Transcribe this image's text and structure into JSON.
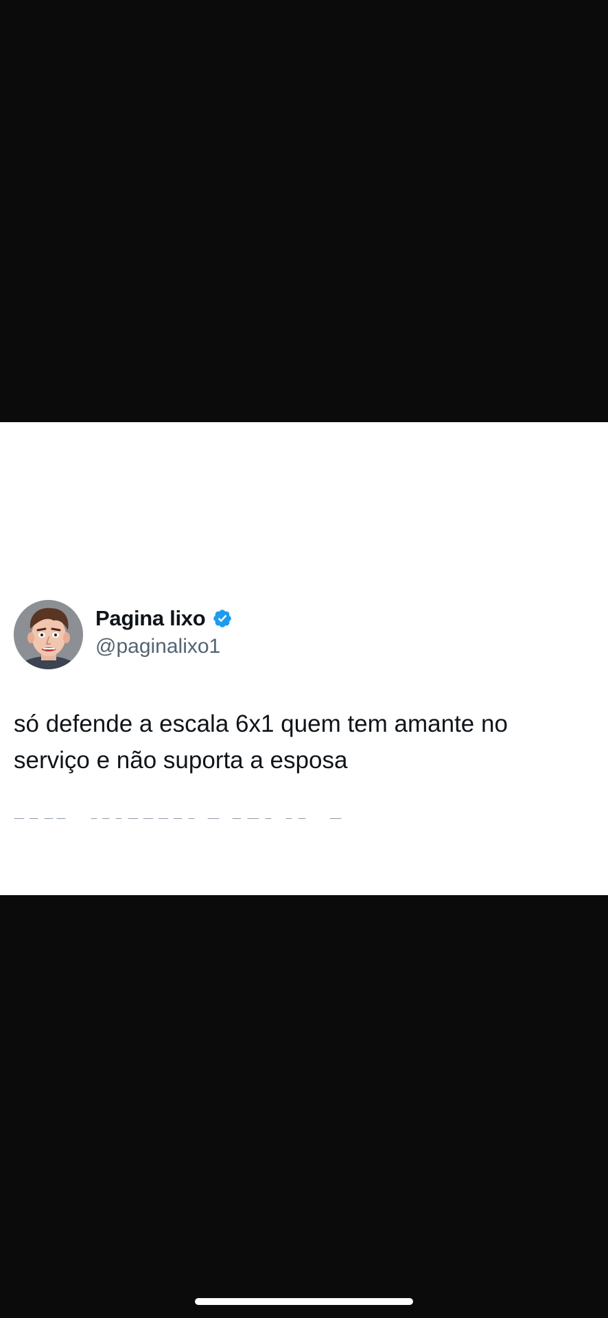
{
  "tweet": {
    "display_name": "Pagina lixo",
    "handle": "@paginalixo1",
    "text": "só defende a escala 6x1 quem tem amante no serviço e não suporta a esposa",
    "verified": true,
    "verified_icon": "verified-badge-icon",
    "verified_color": "#1d9bf0",
    "avatar_icon": "cartoon-face-avatar"
  },
  "colors": {
    "background": "#0b0b0b",
    "card": "#ffffff",
    "text_primary": "#0f1419",
    "text_secondary": "#536471"
  }
}
